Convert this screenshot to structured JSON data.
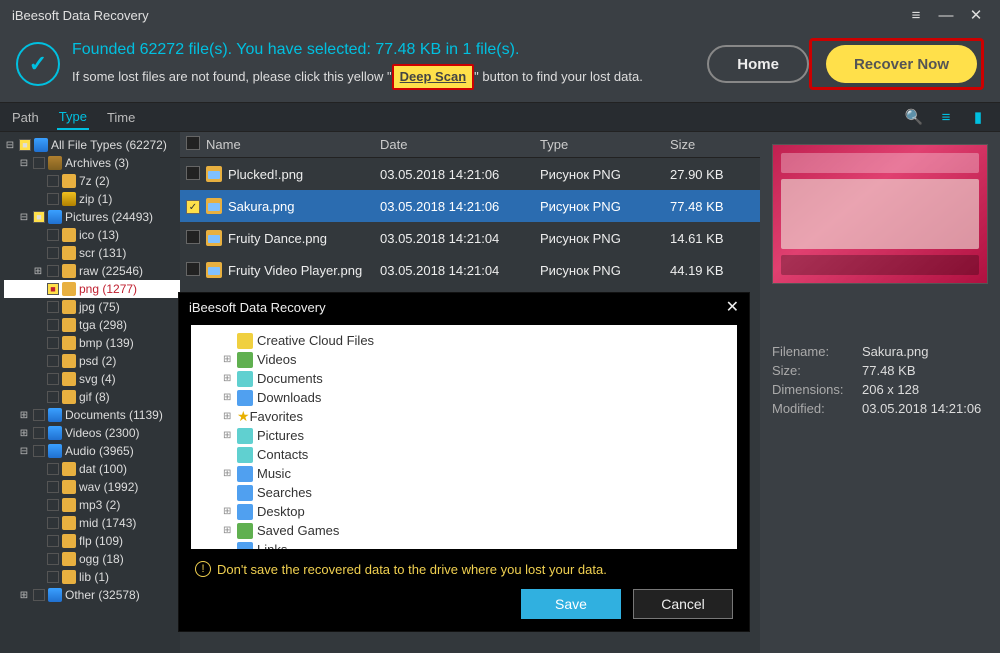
{
  "title": "iBeesoft Data Recovery",
  "banner": {
    "head": "Founded 62272 file(s).  You have selected: 77.48 KB in 1 file(s).",
    "pre": "If some lost files are not found, please click this yellow \"",
    "deep": "Deep Scan",
    "post": "\" button to find your lost data."
  },
  "buttons": {
    "home": "Home",
    "recover": "Recover Now"
  },
  "tabs": {
    "path": "Path",
    "type": "Type",
    "time": "Time"
  },
  "tree": [
    {
      "l": 0,
      "exp": "-",
      "chk": "part",
      "cls": "fi-blue",
      "label": "All File Types (62272)"
    },
    {
      "l": 1,
      "exp": "-",
      "chk": "empty",
      "cls": "fi-brown",
      "label": "Archives (3)"
    },
    {
      "l": 2,
      "exp": "",
      "chk": "empty",
      "cls": "fi-folder",
      "label": "7z (2)"
    },
    {
      "l": 2,
      "exp": "",
      "chk": "empty",
      "cls": "fi-zip",
      "label": "zip (1)"
    },
    {
      "l": 1,
      "exp": "-",
      "chk": "part",
      "cls": "fi-blue",
      "label": "Pictures (24493)"
    },
    {
      "l": 2,
      "exp": "",
      "chk": "empty",
      "cls": "fi-folder",
      "label": "ico (13)"
    },
    {
      "l": 2,
      "exp": "",
      "chk": "empty",
      "cls": "fi-folder",
      "label": "scr (131)"
    },
    {
      "l": 2,
      "exp": "+",
      "chk": "empty",
      "cls": "fi-folder",
      "label": "raw (22546)"
    },
    {
      "l": 2,
      "exp": "",
      "chk": "part",
      "cls": "fi-folder",
      "label": "png (1277)",
      "sel": true
    },
    {
      "l": 2,
      "exp": "",
      "chk": "empty",
      "cls": "fi-folder",
      "label": "jpg (75)"
    },
    {
      "l": 2,
      "exp": "",
      "chk": "empty",
      "cls": "fi-folder",
      "label": "tga (298)"
    },
    {
      "l": 2,
      "exp": "",
      "chk": "empty",
      "cls": "fi-folder",
      "label": "bmp (139)"
    },
    {
      "l": 2,
      "exp": "",
      "chk": "empty",
      "cls": "fi-folder",
      "label": "psd (2)"
    },
    {
      "l": 2,
      "exp": "",
      "chk": "empty",
      "cls": "fi-folder",
      "label": "svg (4)"
    },
    {
      "l": 2,
      "exp": "",
      "chk": "empty",
      "cls": "fi-folder",
      "label": "gif (8)"
    },
    {
      "l": 1,
      "exp": "+",
      "chk": "empty",
      "cls": "fi-blue",
      "label": "Documents (1139)"
    },
    {
      "l": 1,
      "exp": "+",
      "chk": "empty",
      "cls": "fi-blue",
      "label": "Videos (2300)"
    },
    {
      "l": 1,
      "exp": "-",
      "chk": "empty",
      "cls": "fi-blue",
      "label": "Audio (3965)"
    },
    {
      "l": 2,
      "exp": "",
      "chk": "empty",
      "cls": "fi-folder",
      "label": "dat (100)"
    },
    {
      "l": 2,
      "exp": "",
      "chk": "empty",
      "cls": "fi-folder",
      "label": "wav (1992)"
    },
    {
      "l": 2,
      "exp": "",
      "chk": "empty",
      "cls": "fi-folder",
      "label": "mp3 (2)"
    },
    {
      "l": 2,
      "exp": "",
      "chk": "empty",
      "cls": "fi-folder",
      "label": "mid (1743)"
    },
    {
      "l": 2,
      "exp": "",
      "chk": "empty",
      "cls": "fi-folder",
      "label": "flp (109)"
    },
    {
      "l": 2,
      "exp": "",
      "chk": "empty",
      "cls": "fi-folder",
      "label": "ogg (18)"
    },
    {
      "l": 2,
      "exp": "",
      "chk": "empty",
      "cls": "fi-folder",
      "label": "lib (1)"
    },
    {
      "l": 1,
      "exp": "+",
      "chk": "empty",
      "cls": "fi-blue",
      "label": "Other (32578)"
    }
  ],
  "cols": {
    "name": "Name",
    "date": "Date",
    "type": "Type",
    "size": "Size"
  },
  "rows": [
    {
      "chk": false,
      "name": "Plucked!.png",
      "date": "03.05.2018 14:21:06",
      "type": "Рисунок PNG",
      "size": "27.90 KB"
    },
    {
      "chk": true,
      "sel": true,
      "name": "Sakura.png",
      "date": "03.05.2018 14:21:06",
      "type": "Рисунок PNG",
      "size": "77.48 KB"
    },
    {
      "chk": false,
      "name": "Fruity Dance.png",
      "date": "03.05.2018 14:21:04",
      "type": "Рисунок PNG",
      "size": "14.61 KB"
    },
    {
      "chk": false,
      "name": "Fruity Video Player.png",
      "date": "03.05.2018 14:21:04",
      "type": "Рисунок PNG",
      "size": "44.19 KB"
    }
  ],
  "preview": {
    "filename_l": "Filename:",
    "filename": "Sakura.png",
    "size_l": "Size:",
    "size": "77.48 KB",
    "dim_l": "Dimensions:",
    "dim": "206 x 128",
    "mod_l": "Modified:",
    "mod": "03.05.2018 14:21:06"
  },
  "dialog": {
    "title": "iBeesoft Data Recovery",
    "folders": [
      {
        "exp": "",
        "ico": "y",
        "label": "Creative Cloud Files"
      },
      {
        "exp": "+",
        "ico": "g",
        "label": "Videos"
      },
      {
        "exp": "+",
        "ico": "c",
        "label": "Documents"
      },
      {
        "exp": "+",
        "ico": "b",
        "label": "Downloads"
      },
      {
        "exp": "+",
        "ico": "star",
        "label": "Favorites"
      },
      {
        "exp": "+",
        "ico": "c",
        "label": "Pictures"
      },
      {
        "exp": "",
        "ico": "c",
        "label": "Contacts"
      },
      {
        "exp": "+",
        "ico": "b",
        "label": "Music"
      },
      {
        "exp": "",
        "ico": "b",
        "label": "Searches"
      },
      {
        "exp": "+",
        "ico": "b",
        "label": "Desktop"
      },
      {
        "exp": "+",
        "ico": "g",
        "label": "Saved Games"
      },
      {
        "exp": "",
        "ico": "b",
        "label": "Links"
      }
    ],
    "warn": "Don't save the recovered data to the drive where you lost your data.",
    "save": "Save",
    "cancel": "Cancel"
  }
}
